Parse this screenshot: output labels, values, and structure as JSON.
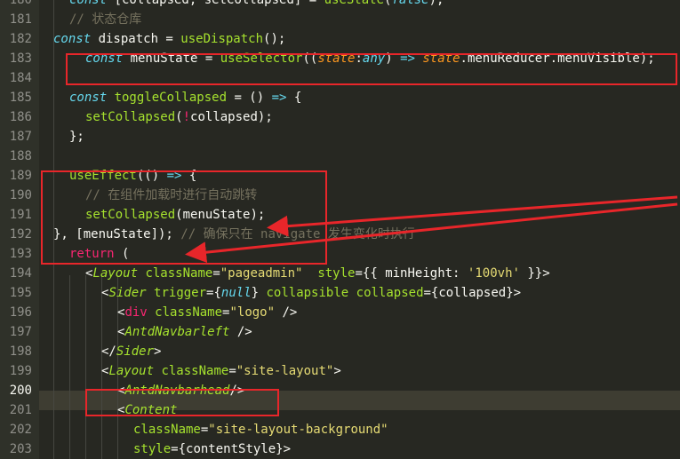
{
  "editor": {
    "active_line": "200",
    "lines": [
      {
        "num": "180",
        "parts": [
          [
            "kw",
            "const "
          ],
          [
            "plain",
            "[collapsed, setCollapsed] = "
          ],
          [
            "fn",
            "useState"
          ],
          [
            "plain",
            "("
          ],
          [
            "kw",
            "false"
          ],
          [
            "plain",
            ");"
          ]
        ]
      },
      {
        "num": "181",
        "parts": [
          [
            "cm",
            "// 状态仓库"
          ]
        ]
      },
      {
        "num": "182",
        "parts": [
          [
            "kw",
            "const "
          ],
          [
            "plain",
            "dispatch = "
          ],
          [
            "fn",
            "useDispatch"
          ],
          [
            "plain",
            "();"
          ]
        ]
      },
      {
        "num": "183",
        "parts": [
          [
            "kw",
            "const "
          ],
          [
            "plain",
            "menuState = "
          ],
          [
            "fn",
            "useSelector"
          ],
          [
            "plain",
            "(("
          ],
          [
            "param",
            "state"
          ],
          [
            "plain",
            ":"
          ],
          [
            "type",
            "any"
          ],
          [
            "plain",
            ") "
          ],
          [
            "kw",
            "=>"
          ],
          [
            "plain",
            " "
          ],
          [
            "param",
            "state"
          ],
          [
            "plain",
            ".menuReducer.menuVisible);"
          ]
        ]
      },
      {
        "num": "184",
        "parts": []
      },
      {
        "num": "185",
        "parts": [
          [
            "kw",
            "const "
          ],
          [
            "fn",
            "toggleCollapsed"
          ],
          [
            "plain",
            " = () "
          ],
          [
            "kw",
            "=>"
          ],
          [
            "plain",
            " {"
          ]
        ]
      },
      {
        "num": "186",
        "parts": [
          [
            "fn",
            "setCollapsed"
          ],
          [
            "plain",
            "("
          ],
          [
            "op",
            "!"
          ],
          [
            "plain",
            "collapsed);"
          ]
        ]
      },
      {
        "num": "187",
        "parts": [
          [
            "plain",
            "};"
          ]
        ]
      },
      {
        "num": "188",
        "parts": []
      },
      {
        "num": "189",
        "parts": [
          [
            "fn",
            "useEffect"
          ],
          [
            "plain",
            "(() "
          ],
          [
            "kw",
            "=>"
          ],
          [
            "plain",
            " {"
          ]
        ]
      },
      {
        "num": "190",
        "parts": [
          [
            "cm",
            "// 在组件加载时进行自动跳转"
          ]
        ]
      },
      {
        "num": "191",
        "parts": [
          [
            "fn",
            "setCollapsed"
          ],
          [
            "plain",
            "(menuState);"
          ]
        ]
      },
      {
        "num": "192",
        "parts": [
          [
            "plain",
            "}, [menuState]); "
          ],
          [
            "cm",
            "// 确保只在 navigate 发生变化时执行"
          ]
        ]
      },
      {
        "num": "193",
        "parts": [
          [
            "op",
            "return"
          ],
          [
            "plain",
            " ("
          ]
        ]
      },
      {
        "num": "194",
        "parts": [
          [
            "plain",
            "<"
          ],
          [
            "comp",
            "Layout"
          ],
          [
            "plain",
            " "
          ],
          [
            "attr",
            "className"
          ],
          [
            "plain",
            "="
          ],
          [
            "str",
            "\"pageadmin\""
          ],
          [
            "plain",
            "  "
          ],
          [
            "attr",
            "style"
          ],
          [
            "plain",
            "={{ minHeight: "
          ],
          [
            "str",
            "'100vh'"
          ],
          [
            "plain",
            " }}>"
          ]
        ]
      },
      {
        "num": "195",
        "parts": [
          [
            "plain",
            "<"
          ],
          [
            "comp",
            "Sider"
          ],
          [
            "plain",
            " "
          ],
          [
            "attr",
            "trigger"
          ],
          [
            "plain",
            "={"
          ],
          [
            "kw",
            "null"
          ],
          [
            "plain",
            "} "
          ],
          [
            "attr",
            "collapsible"
          ],
          [
            "plain",
            " "
          ],
          [
            "attr",
            "collapsed"
          ],
          [
            "plain",
            "={collapsed}>"
          ]
        ]
      },
      {
        "num": "196",
        "parts": [
          [
            "plain",
            "<"
          ],
          [
            "tag",
            "div"
          ],
          [
            "plain",
            " "
          ],
          [
            "attr",
            "className"
          ],
          [
            "plain",
            "="
          ],
          [
            "str",
            "\"logo\""
          ],
          [
            "plain",
            " />"
          ]
        ]
      },
      {
        "num": "197",
        "parts": [
          [
            "plain",
            "<"
          ],
          [
            "comp",
            "AntdNavbarleft"
          ],
          [
            "plain",
            " />"
          ]
        ]
      },
      {
        "num": "198",
        "parts": [
          [
            "plain",
            "</"
          ],
          [
            "comp",
            "Sider"
          ],
          [
            "plain",
            ">"
          ]
        ]
      },
      {
        "num": "199",
        "parts": [
          [
            "plain",
            "<"
          ],
          [
            "comp",
            "Layout"
          ],
          [
            "plain",
            " "
          ],
          [
            "attr",
            "className"
          ],
          [
            "plain",
            "="
          ],
          [
            "str",
            "\"site-layout\""
          ],
          [
            "plain",
            ">"
          ]
        ]
      },
      {
        "num": "200",
        "parts": [
          [
            "plain",
            "<"
          ],
          [
            "comp",
            "AntdNavbarhead"
          ],
          [
            "plain",
            "/>"
          ]
        ]
      },
      {
        "num": "201",
        "parts": [
          [
            "plain",
            "<"
          ],
          [
            "comp",
            "Content"
          ]
        ]
      },
      {
        "num": "202",
        "parts": [
          [
            "attr",
            "className"
          ],
          [
            "plain",
            "="
          ],
          [
            "str",
            "\"site-layout-background\""
          ]
        ]
      },
      {
        "num": "203",
        "parts": [
          [
            "attr",
            "style"
          ],
          [
            "plain",
            "={contentStyle}>"
          ]
        ]
      }
    ]
  }
}
